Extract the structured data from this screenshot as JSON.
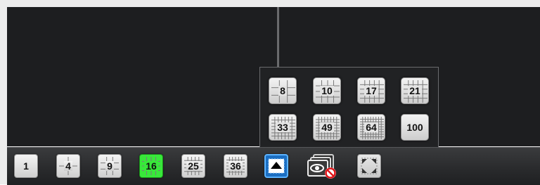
{
  "toolbar": {
    "layouts": [
      {
        "label": "1",
        "grid": 1
      },
      {
        "label": "4",
        "grid": 2
      },
      {
        "label": "9",
        "grid": 3
      },
      {
        "label": "16",
        "grid": 4,
        "active": true
      },
      {
        "label": "25",
        "grid": 5
      },
      {
        "label": "36",
        "grid": 6
      }
    ],
    "active_color": "#38e83a",
    "selected_color": "#1b6ec2"
  },
  "popup": {
    "layouts": [
      {
        "label": "8",
        "grid": 3
      },
      {
        "label": "10",
        "grid": 4
      },
      {
        "label": "17",
        "grid": 5
      },
      {
        "label": "21",
        "grid": 5
      },
      {
        "label": "33",
        "grid": 7
      },
      {
        "label": "49",
        "grid": 8
      },
      {
        "label": "64",
        "grid": 9
      },
      {
        "label": "100",
        "grid": 0
      }
    ]
  },
  "icons": {
    "expand": "expand-more-layouts-icon",
    "stop_sequence": "stop-camera-sequence-icon",
    "fullscreen": "fullscreen-icon"
  }
}
